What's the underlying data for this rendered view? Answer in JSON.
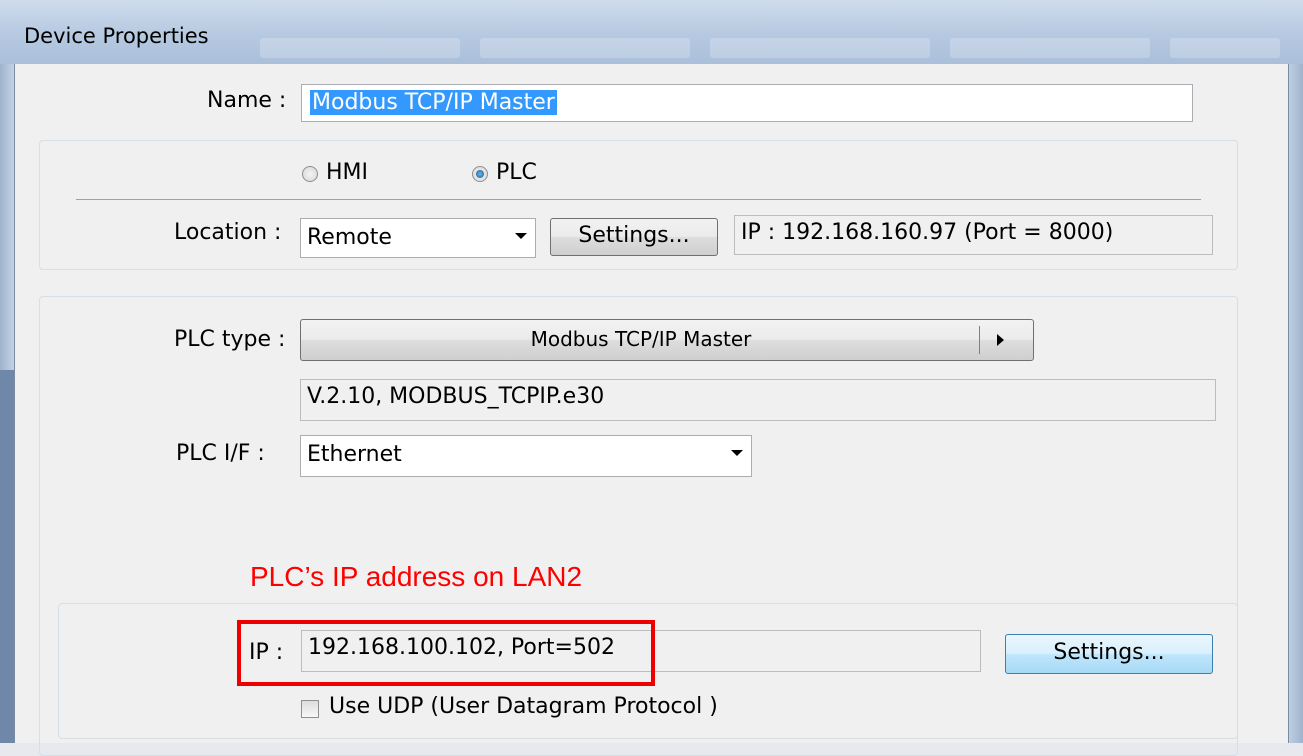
{
  "window": {
    "title": "Device Properties"
  },
  "name_field": {
    "label": "Name :",
    "value": "Modbus TCP/IP Master"
  },
  "device_kind": {
    "options": [
      {
        "label": "HMI",
        "selected": false
      },
      {
        "label": "PLC",
        "selected": true
      }
    ]
  },
  "location": {
    "label": "Location :",
    "value": "Remote",
    "settings_label": "Settings...",
    "ip_display": "IP : 192.168.160.97 (Port = 8000)"
  },
  "plc": {
    "type_label": "PLC type :",
    "type_value": "Modbus TCP/IP Master",
    "version": "V.2.10, MODBUS_TCPIP.e30",
    "if_label": "PLC I/F :",
    "if_value": "Ethernet"
  },
  "annotation": {
    "text": "PLC’s IP address on LAN2",
    "color": "#ff0000"
  },
  "ip_settings": {
    "label": "IP :",
    "value": "192.168.100.102,  Port=502",
    "settings_label": "Settings...",
    "udp_label": "Use UDP (User Datagram Protocol )",
    "udp_checked": false
  },
  "icons": [
    "dropdown-arrow-icon",
    "submenu-arrow-icon"
  ]
}
